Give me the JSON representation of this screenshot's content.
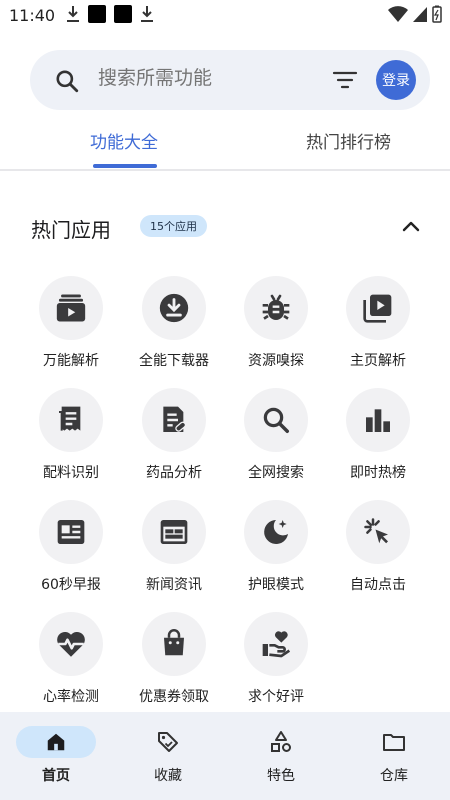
{
  "status_bar": {
    "time": "11:40"
  },
  "search": {
    "placeholder": "搜索所需功能",
    "login_label": "登录"
  },
  "tabs": [
    {
      "label": "功能大全",
      "active": true
    },
    {
      "label": "热门排行榜",
      "active": false
    }
  ],
  "section": {
    "title": "热门应用",
    "badge": "15个应用"
  },
  "apps": [
    {
      "label": "万能解析",
      "icon": "video-stack-icon"
    },
    {
      "label": "全能下载器",
      "icon": "download-circle-icon"
    },
    {
      "label": "资源嗅探",
      "icon": "bug-icon"
    },
    {
      "label": "主页解析",
      "icon": "play-library-icon"
    },
    {
      "label": "配料识别",
      "icon": "receipt-icon"
    },
    {
      "label": "药品分析",
      "icon": "medical-doc-icon"
    },
    {
      "label": "全网搜索",
      "icon": "search-icon"
    },
    {
      "label": "即时热榜",
      "icon": "bar-chart-icon"
    },
    {
      "label": "60秒早报",
      "icon": "newspaper-icon"
    },
    {
      "label": "新闻资讯",
      "icon": "calendar-view-icon"
    },
    {
      "label": "护眼模式",
      "icon": "night-mode-icon"
    },
    {
      "label": "自动点击",
      "icon": "auto-click-icon"
    },
    {
      "label": "心率检测",
      "icon": "heart-rate-icon"
    },
    {
      "label": "优惠券领取",
      "icon": "shopping-bag-icon"
    },
    {
      "label": "求个好评",
      "icon": "hand-heart-icon"
    }
  ],
  "bottom_nav": [
    {
      "label": "首页",
      "icon": "home-icon",
      "active": true
    },
    {
      "label": "收藏",
      "icon": "tag-icon",
      "active": false
    },
    {
      "label": "特色",
      "icon": "shapes-icon",
      "active": false
    },
    {
      "label": "仓库",
      "icon": "folder-icon",
      "active": false
    }
  ],
  "colors": {
    "accent": "#3f6bd6",
    "badge_bg": "#cfe6fb",
    "surface": "#eef1f7",
    "icon": "#3a3a3c"
  }
}
